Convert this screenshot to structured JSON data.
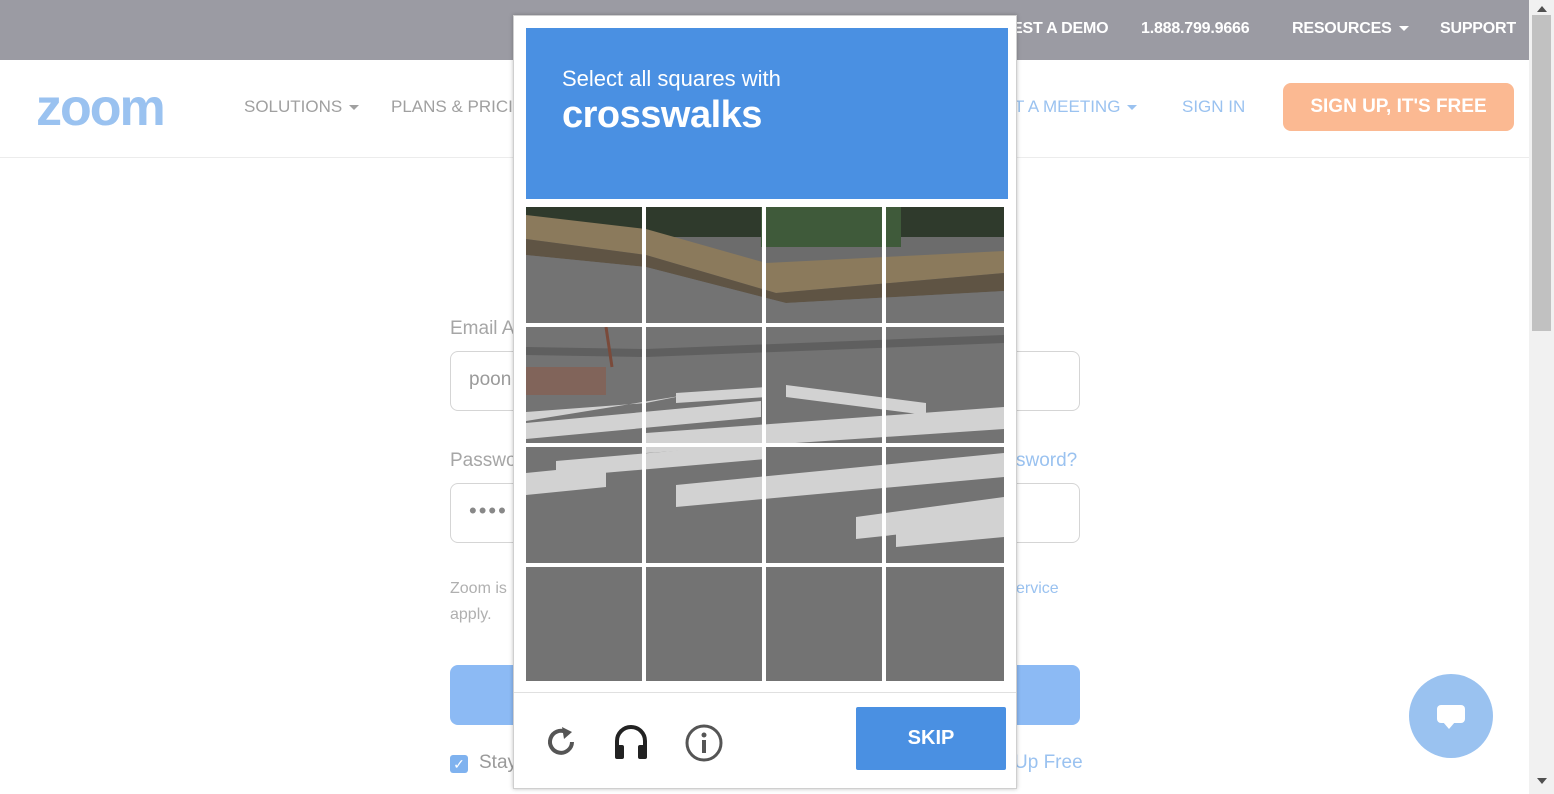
{
  "topbar": {
    "request_demo": "EST A DEMO",
    "phone": "1.888.799.9666",
    "resources": "RESOURCES",
    "support": "SUPPORT"
  },
  "nav": {
    "logo": "zoom",
    "solutions": "SOLUTIONS",
    "plans": "PLANS & PRICI",
    "host_meeting": "T A MEETING",
    "sign_in": "SIGN IN",
    "sign_up": "SIGN UP, IT'S FREE"
  },
  "form": {
    "email_label": "Email A",
    "email_value": "poon",
    "password_label": "Passwo",
    "forgot_password": "sword?",
    "password_value": "••••",
    "terms_line1": "Zoom is",
    "terms_service": "ervice",
    "terms_line2": "apply.",
    "stay_label": "Stay",
    "stay_checked": true,
    "signup_free": "Up Free"
  },
  "captcha": {
    "instruction": "Select all squares with",
    "keyword": "crosswalks",
    "skip_label": "SKIP",
    "tiles_count": 16
  },
  "colors": {
    "accent": "#4a90e2",
    "zoom_blue": "#9ac2f0",
    "signup_orange": "#fbb992",
    "topbar": "#9b9ba3"
  }
}
